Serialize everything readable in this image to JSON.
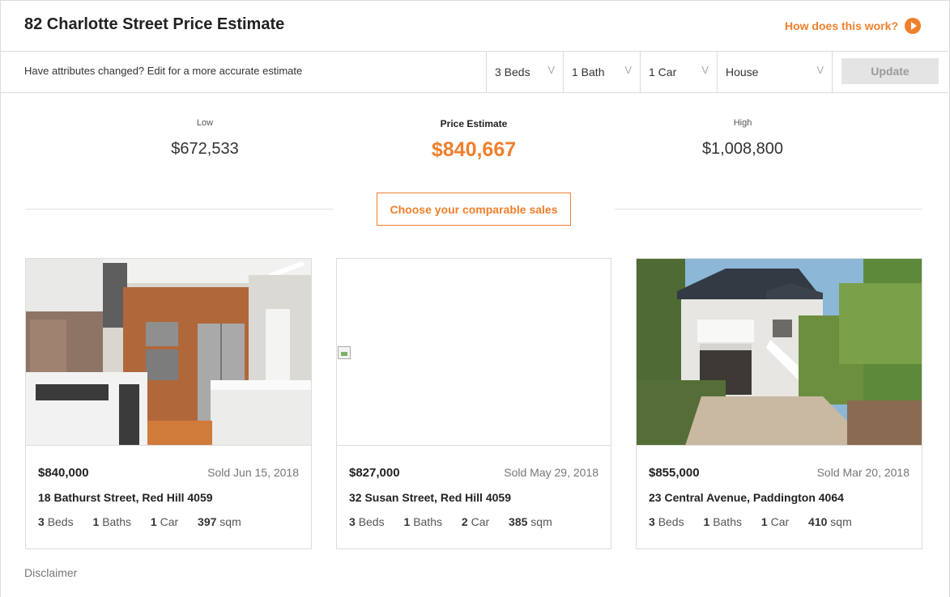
{
  "header": {
    "title": "82 Charlotte Street Price Estimate",
    "how_link": "How does this work?"
  },
  "attributes": {
    "prompt": "Have attributes changed? Edit for a more accurate estimate",
    "beds": "3 Beds",
    "baths": "1 Bath",
    "cars": "1 Car",
    "type": "House",
    "update_label": "Update"
  },
  "estimate": {
    "low_label": "Low",
    "low_value": "$672,533",
    "mid_label": "Price Estimate",
    "mid_value": "$840,667",
    "high_label": "High",
    "high_value": "$1,008,800",
    "accent_color": "#f07f2c"
  },
  "choose_label": "Choose your comparable sales",
  "cards": [
    {
      "price": "$840,000",
      "sold": "Sold Jun 15, 2018",
      "address": "18 Bathurst Street, Red Hill 4059",
      "beds_n": "3",
      "beds_u": "Beds",
      "baths_n": "1",
      "baths_u": "Baths",
      "cars_n": "1",
      "cars_u": "Car",
      "area_n": "397",
      "area_u": "sqm"
    },
    {
      "price": "$827,000",
      "sold": "Sold May 29, 2018",
      "address": "32 Susan Street, Red Hill 4059",
      "beds_n": "3",
      "beds_u": "Beds",
      "baths_n": "1",
      "baths_u": "Baths",
      "cars_n": "2",
      "cars_u": "Car",
      "area_n": "385",
      "area_u": "sqm"
    },
    {
      "price": "$855,000",
      "sold": "Sold Mar 20, 2018",
      "address": "23 Central Avenue, Paddington 4064",
      "beds_n": "3",
      "beds_u": "Beds",
      "baths_n": "1",
      "baths_u": "Baths",
      "cars_n": "1",
      "cars_u": "Car",
      "area_n": "410",
      "area_u": "sqm"
    }
  ],
  "disclaimer": "Disclaimer"
}
